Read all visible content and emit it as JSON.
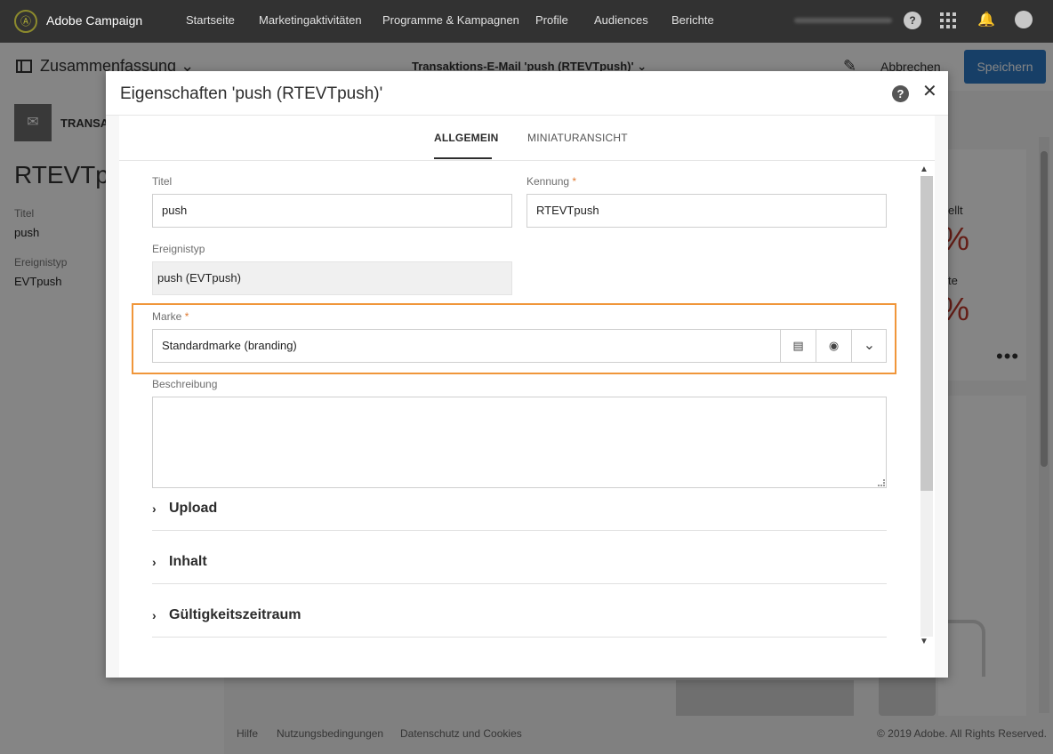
{
  "app": {
    "brand": "Adobe Campaign",
    "logo_glyph": "Ⓐ"
  },
  "nav": {
    "links": [
      "Startseite",
      "Marketingaktivitäten",
      "Programme & Kampagnen",
      "Profile",
      "Audiences",
      "Berichte"
    ],
    "help_glyph": "?",
    "bell_glyph": "🔔"
  },
  "subheader": {
    "summary": "Zusammenfassung ⌄",
    "document_title": "Transaktions-E-Mail 'push (RTEVTpush)' ⌄",
    "cancel": "Abbrechen",
    "save": "Speichern",
    "pencil_glyph": "✎"
  },
  "left_panel": {
    "type_label": "TRANSAC",
    "big_title": "RTEVTpus",
    "title_label": "Titel",
    "title_value": "push",
    "event_label": "Ereignistyp",
    "event_value": "EVTpush"
  },
  "right_panel": {
    "card1_label": "ellt",
    "card1_value": "%",
    "card2_label": "te",
    "card2_value": "%",
    "more": "•••"
  },
  "footer": {
    "help": "Hilfe",
    "terms": "Nutzungsbedingungen",
    "privacy": "Datenschutz und Cookies",
    "copyright": "© 2019 Adobe. All Rights Reserved."
  },
  "dialog": {
    "title": "Eigenschaften 'push (RTEVTpush)'",
    "help_glyph": "?",
    "close_glyph": "✕",
    "tabs": [
      {
        "label": "ALLGEMEIN",
        "active": true
      },
      {
        "label": "MINIATURANSICHT",
        "active": false
      }
    ],
    "fields": {
      "title_label": "Titel",
      "title_value": "push",
      "id_label": "Kennung",
      "id_value": "RTEVTpush",
      "required_mark": "*",
      "event_label": "Ereignistyp",
      "event_value": "push (EVTpush)",
      "brand_label": "Marke",
      "brand_value": "Standardmarke (branding)",
      "description_label": "Beschreibung",
      "description_value": ""
    },
    "sections": [
      "Upload",
      "Inhalt",
      "Gültigkeitszeitraum"
    ],
    "section_chevron": "›",
    "brand_buttons": {
      "folder": "▤",
      "eye": "◉",
      "dropdown": "⌄"
    },
    "scroll": {
      "up": "▲",
      "down": "▼"
    }
  },
  "colors": {
    "accent": "#2d7ac6",
    "highlight": "#f0963a",
    "nav_bg": "#323232",
    "required": "#e07b32"
  }
}
